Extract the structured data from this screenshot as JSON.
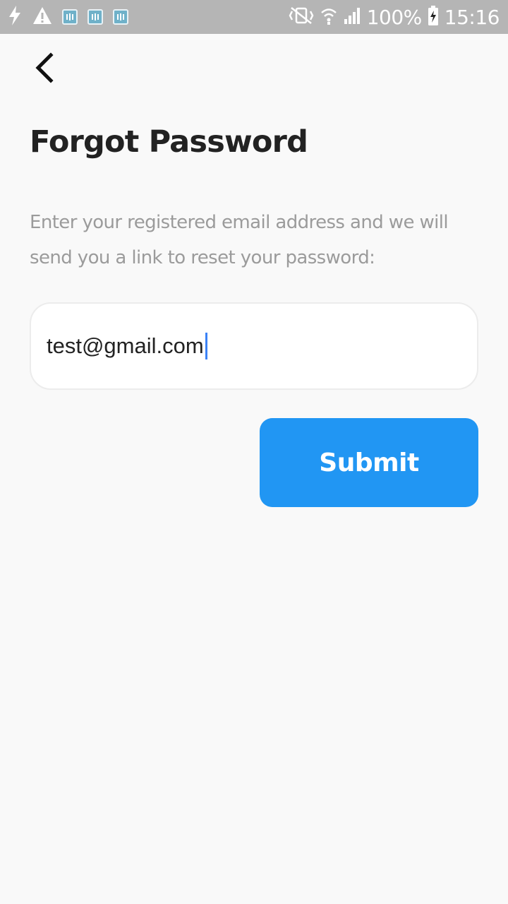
{
  "status_bar": {
    "battery": "100%",
    "time": "15:16",
    "icons": [
      "flash-icon",
      "warning-icon",
      "app-notification-icon",
      "app-notification-icon",
      "app-notification-icon",
      "vibrate-icon",
      "wifi-icon",
      "signal-icon",
      "battery-charging-icon"
    ]
  },
  "header": {
    "back_icon": "chevron-left-icon"
  },
  "page": {
    "title": "Forgot Password",
    "description": "Enter your registered email address and we will send you a link to reset your password:"
  },
  "form": {
    "email_value": "test@gmail.com",
    "submit_label": "Submit"
  },
  "colors": {
    "background": "#f9f9f9",
    "status_bar": "#b5b5b5",
    "primary": "#2196f3",
    "title": "#222222",
    "description": "#9b9b9b",
    "caret": "#3b82f6"
  }
}
